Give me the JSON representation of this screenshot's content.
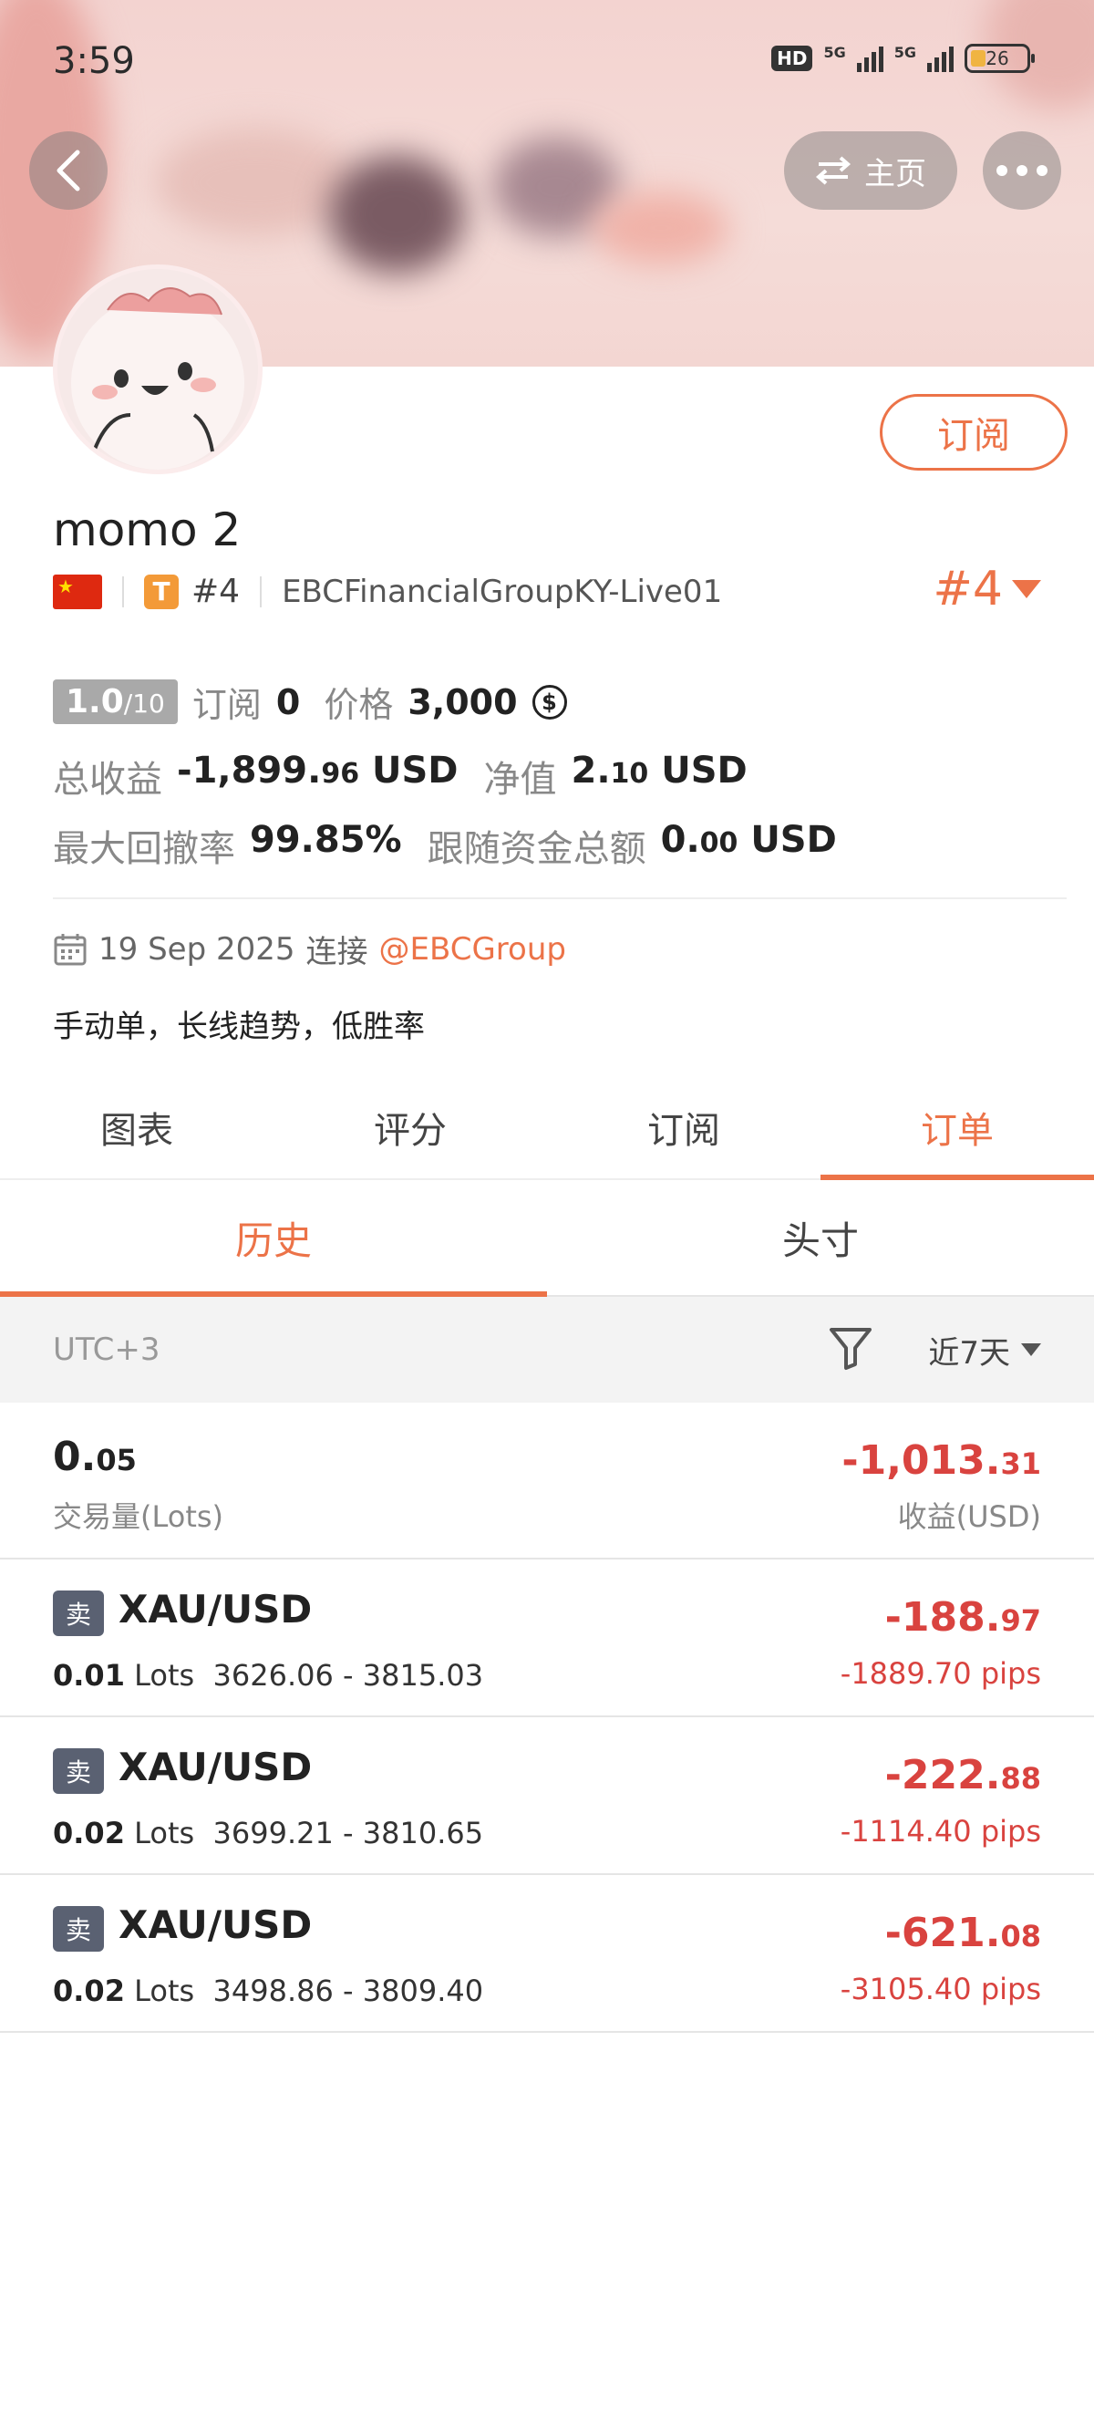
{
  "status_bar": {
    "time": "3:59",
    "hd": "HD",
    "net1": "5G",
    "net2": "5G",
    "battery": "26"
  },
  "header": {
    "home_label": "主页"
  },
  "profile": {
    "name": "momo 2",
    "subscribe_label": "订阅",
    "rank_badge": "#4",
    "broker": "EBCFinancialGroupKY-Live01",
    "rank_right": "#4",
    "score_main": "1.0",
    "score_den": "/10",
    "subs_label": "订阅",
    "subs_value": "0",
    "price_label": "价格",
    "price_value": "3,000",
    "total_label": "总收益",
    "total_main": "-1,899.",
    "total_dec": "96",
    "total_unit": "USD",
    "nav_label": "净值",
    "nav_main": "2.",
    "nav_dec": "10",
    "nav_unit": "USD",
    "dd_label": "最大回撤率",
    "dd_value": "99.85%",
    "follow_label": "跟随资金总额",
    "follow_main": "0.",
    "follow_dec": "00",
    "follow_unit": "USD",
    "joined_date": "19 Sep 2025",
    "joined_word": "连接",
    "joined_link": "@EBCGroup",
    "description": "手动单，长线趋势，低胜率"
  },
  "tabs": [
    "图表",
    "评分",
    "订阅",
    "订单"
  ],
  "subtabs": [
    "历史",
    "头寸"
  ],
  "filter": {
    "timezone": "UTC+3",
    "range": "近7天"
  },
  "summary": {
    "volume_main": "0.",
    "volume_dec": "05",
    "volume_label": "交易量(Lots)",
    "pnl_main": "-1,013.",
    "pnl_dec": "31",
    "pnl_label": "收益(USD)"
  },
  "orders": [
    {
      "side": "卖",
      "symbol": "XAU/USD",
      "lots": "0.01",
      "lots_unit": "Lots",
      "range": "3626.06 - 3815.03",
      "pnl_main": "-188.",
      "pnl_dec": "97",
      "pips": "-1889.70 pips"
    },
    {
      "side": "卖",
      "symbol": "XAU/USD",
      "lots": "0.02",
      "lots_unit": "Lots",
      "range": "3699.21 - 3810.65",
      "pnl_main": "-222.",
      "pnl_dec": "88",
      "pips": "-1114.40 pips"
    },
    {
      "side": "卖",
      "symbol": "XAU/USD",
      "lots": "0.02",
      "lots_unit": "Lots",
      "range": "3498.86 - 3809.40",
      "pnl_main": "-621.",
      "pnl_dec": "08",
      "pips": "-3105.40 pips"
    }
  ]
}
